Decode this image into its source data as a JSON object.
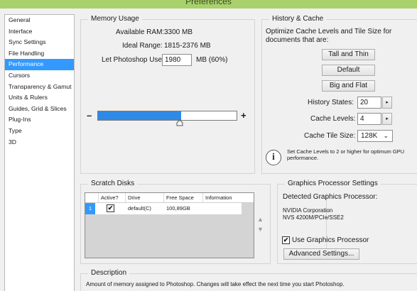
{
  "window": {
    "title": "Preferences"
  },
  "sidebar": {
    "items": [
      {
        "label": "General",
        "active": false
      },
      {
        "label": "Interface",
        "active": false
      },
      {
        "label": "Sync Settings",
        "active": false
      },
      {
        "label": "File Handling",
        "active": false
      },
      {
        "label": "Performance",
        "active": true
      },
      {
        "label": "Cursors",
        "active": false
      },
      {
        "label": "Transparency & Gamut",
        "active": false
      },
      {
        "label": "Units & Rulers",
        "active": false
      },
      {
        "label": "Guides, Grid & Slices",
        "active": false
      },
      {
        "label": "Plug-Ins",
        "active": false
      },
      {
        "label": "Type",
        "active": false
      },
      {
        "label": "3D",
        "active": false
      }
    ]
  },
  "memory": {
    "title": "Memory Usage",
    "available_label": "Available RAM:",
    "available_value": "3300 MB",
    "ideal_label": "Ideal Range:",
    "ideal_value": "1815-2376 MB",
    "let_label": "Let Photoshop Use:",
    "let_value": "1980",
    "let_unit": "MB (60%)",
    "minus": "–",
    "plus": "+",
    "slider_fraction": 0.6
  },
  "history": {
    "title": "History & Cache",
    "desc": "Optimize Cache Levels and Tile Size for documents that are:",
    "btn_tall": "Tall and Thin",
    "btn_default": "Default",
    "btn_big": "Big and Flat",
    "states_label": "History States:",
    "states_value": "20",
    "levels_label": "Cache Levels:",
    "levels_value": "4",
    "tile_label": "Cache Tile Size:",
    "tile_value": "128K",
    "note": "Set Cache Levels to 2 or higher for optimum GPU performance.",
    "spin_arrow": "▸",
    "dropdown_arrow": "⌄"
  },
  "scratch": {
    "title": "Scratch Disks",
    "columns": [
      "Active?",
      "Drive",
      "Free Space",
      "Information"
    ],
    "rows": [
      {
        "num": "1",
        "active": "✔",
        "drive": "default(C)",
        "free": "100,89GB",
        "info": ""
      }
    ],
    "up_arrow": "▲",
    "down_arrow": "▼"
  },
  "gpu": {
    "title": "Graphics Processor Settings",
    "detected_label": "Detected Graphics Processor:",
    "vendor": "NVIDIA Corporation",
    "model": "NVS 4200M/PCIe/SSE2",
    "use_gpu_label": "Use Graphics Processor",
    "use_gpu_check": "✔",
    "advanced_label": "Advanced Settings..."
  },
  "description": {
    "title": "Description",
    "text": "Amount of memory assigned to Photoshop. Changes will take effect the next time you start Photoshop."
  },
  "colors": {
    "accent": "#3399ff",
    "slider_fill": "#2f8ae6",
    "titlebar": "#a9d16b"
  }
}
